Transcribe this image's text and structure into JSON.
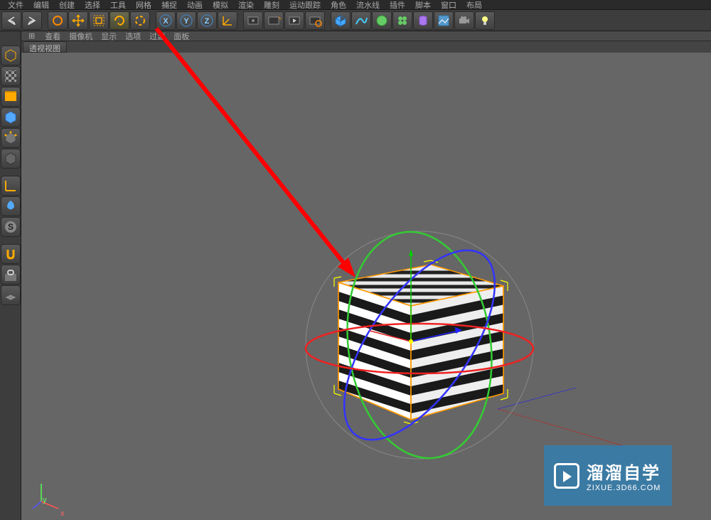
{
  "menu": {
    "items": [
      "文件",
      "编辑",
      "创建",
      "选择",
      "工具",
      "网格",
      "捕捉",
      "动画",
      "模拟",
      "渲染",
      "雕刻",
      "运动跟踪",
      "角色",
      "流水线",
      "插件",
      "脚本",
      "窗口",
      "布局"
    ]
  },
  "toolbar": {
    "undo": "undo-icon",
    "redo": "redo-icon",
    "select": "select-arrow-icon",
    "move": "move-icon",
    "scale": "scale-icon",
    "rotate": "rotate-icon",
    "last": "last-tool-icon",
    "x": "X",
    "y": "Y",
    "z": "Z",
    "coord": "coord-icon",
    "render1": "render-icon",
    "render2": "render-region-icon",
    "render3": "render-settings-icon",
    "render4": "render-ext-icon",
    "cube": "cube-icon",
    "spline": "spline-icon",
    "nurbs": "nurbs-icon",
    "generator": "generator-icon",
    "deformer": "deformer-icon",
    "env": "environment-icon",
    "camera": "camera-icon",
    "light": "light-icon"
  },
  "leftToolbar": {
    "make_editable": "make-editable-icon",
    "model": "model-icon",
    "texture": "texture-icon",
    "workplane": "workplane-icon",
    "points": "points-icon",
    "edges": "edges-icon",
    "polygons": "polygons-icon",
    "axis": "axis-icon",
    "mirror": "mirror-icon",
    "soft": "soft-selection-icon",
    "snap1": "snap-icon",
    "snap2": "snap-settings-icon",
    "snap3": "snap-grid-icon"
  },
  "viewportMenu": {
    "items": [
      "查看",
      "摄像机",
      "显示",
      "选项",
      "过滤",
      "面板"
    ]
  },
  "viewportTab": "透视视图",
  "watermark": {
    "line1": "溜溜自学",
    "line2": "ZIXUE.3D66.COM"
  },
  "axis": {
    "y": "y",
    "x": "x"
  }
}
